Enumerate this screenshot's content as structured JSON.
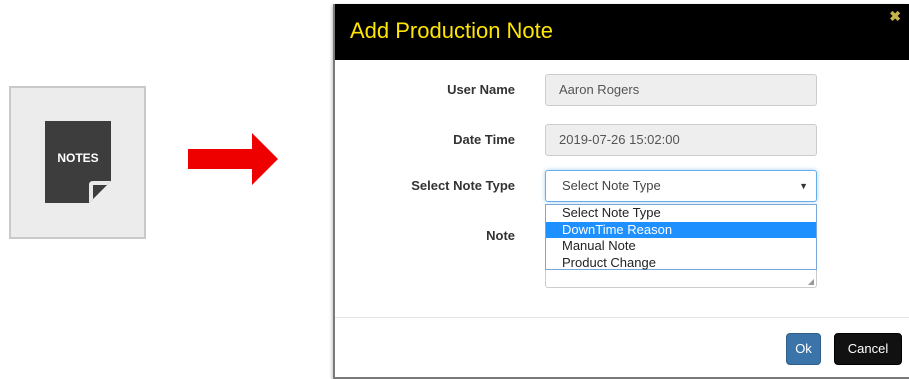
{
  "notes_button": {
    "label": "NOTES",
    "icon": "notes-icon"
  },
  "arrow": {
    "icon": "right-arrow-icon",
    "color": "#ee0000"
  },
  "modal": {
    "title": "Add Production Note",
    "close_icon": "close-icon",
    "fields": {
      "user_name": {
        "label": "User Name",
        "value": "Aaron Rogers"
      },
      "date_time": {
        "label": "Date Time",
        "value": "2019-07-26 15:02:00"
      },
      "note_type": {
        "label": "Select Note Type",
        "selected": "Select Note Type",
        "options": [
          "Select Note Type",
          "DownTime Reason",
          "Manual Note",
          "Product Change"
        ],
        "highlighted": "DownTime Reason"
      },
      "note": {
        "label": "Note",
        "value": ""
      }
    },
    "buttons": {
      "ok": "Ok",
      "cancel": "Cancel"
    }
  },
  "colors": {
    "header_bg": "#000000",
    "title": "#ffe600",
    "ok_button": "#3a74a8",
    "cancel_button": "#111111",
    "highlight": "#1e90ff"
  }
}
